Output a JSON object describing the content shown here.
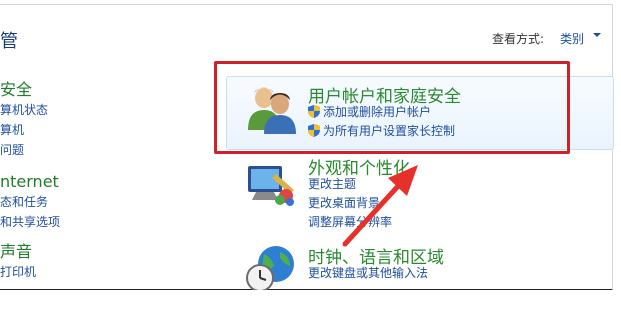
{
  "header": {
    "title_fragment": "管",
    "view_by_label": "查看方式:",
    "view_by_value": "类别"
  },
  "left_column": [
    {
      "title": "安全",
      "links": [
        "算机状态",
        "算机",
        "问题"
      ]
    },
    {
      "title": "nternet",
      "links": [
        "态和任务",
        "和共享选项"
      ]
    },
    {
      "title": "声音",
      "links": [
        "打印机"
      ]
    }
  ],
  "categories": {
    "user_accounts": {
      "title": "用户帐户和家庭安全",
      "links": [
        "添加或删除用户帐户",
        "为所有用户设置家长控制"
      ]
    },
    "appearance": {
      "title": "外观和个性化",
      "links": [
        "更改主题",
        "更改桌面背景",
        "调整屏幕分辨率"
      ]
    },
    "clock_region": {
      "title": "时钟、语言和区域",
      "links": [
        "更改键盘或其他输入法"
      ]
    }
  },
  "colors": {
    "highlight": "#cf2127",
    "arrow": "#e8302a",
    "title_green": "#2a8a2f",
    "link_blue": "#1e4e9f"
  },
  "icons": [
    "users-icon",
    "shield-icon",
    "monitor-paint-icon",
    "globe-clock-icon",
    "chevron-down-icon"
  ]
}
